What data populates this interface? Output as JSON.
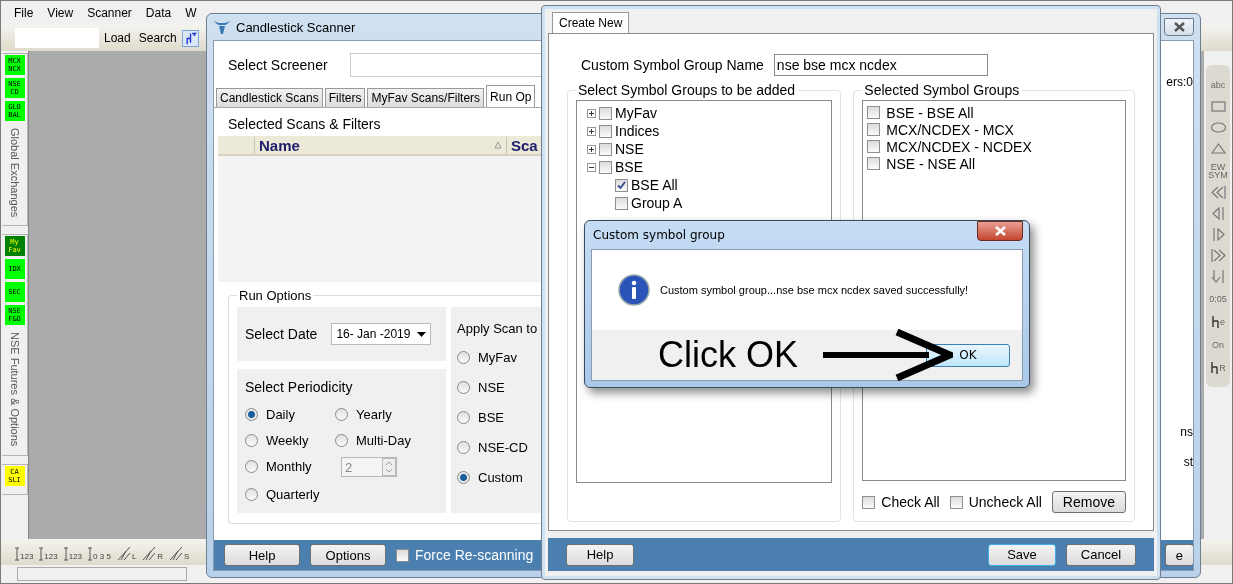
{
  "menu": [
    {
      "label": "File"
    },
    {
      "label": "View"
    },
    {
      "label": "Scanner"
    },
    {
      "label": "Data"
    },
    {
      "label": "W"
    }
  ],
  "toolbar": {
    "buttons": [
      "Load",
      "Search"
    ]
  },
  "sidebar": {
    "groups": [
      {
        "badges": [
          {
            "text": "MCX\nNCX",
            "color": "#00ff00"
          },
          {
            "text": "NSE\nCD",
            "color": "#00ff00"
          },
          {
            "text": "GLO\nBAL",
            "color": "#00ff00"
          }
        ],
        "title": "Global Exchanges"
      },
      {
        "badges": [
          {
            "text": "My\nFav",
            "color": "#008000"
          },
          {
            "text": "IDX",
            "color": "#00ff00"
          },
          {
            "text": "SEC",
            "color": "#00ff00"
          },
          {
            "text": "NSE\nF&O",
            "color": "#00ff00"
          }
        ],
        "title": "NSE Futures & Options"
      },
      {
        "badges": [
          {
            "text": "CA\nSLI",
            "color": "#ffff00"
          }
        ]
      }
    ]
  },
  "bottom_tools": [
    {
      "kind": "numbers",
      "text": "123"
    },
    {
      "kind": "numbers",
      "text": "123"
    },
    {
      "kind": "numbers",
      "text": "123"
    },
    {
      "kind": "numbers",
      "text": "0 3 5"
    },
    {
      "kind": "trend",
      "text": "L"
    },
    {
      "kind": "trend",
      "text": "R"
    },
    {
      "kind": "trend",
      "text": "S"
    }
  ],
  "right_tools": [
    {
      "kind": "text",
      "text": "abc"
    },
    {
      "kind": "rect"
    },
    {
      "kind": "ellipse"
    },
    {
      "kind": "triangle"
    },
    {
      "kind": "text",
      "text": "EW\nSYM"
    },
    {
      "kind": "arrow-left-double"
    },
    {
      "kind": "arrow-left"
    },
    {
      "kind": "arrow-right"
    },
    {
      "kind": "arrow-right-double"
    },
    {
      "kind": "arrow-down"
    },
    {
      "kind": "text",
      "text": "0:05"
    },
    {
      "kind": "cursor",
      "text": "e"
    },
    {
      "kind": "text",
      "text": "On"
    },
    {
      "kind": "cursor",
      "text": "R"
    }
  ],
  "scanner": {
    "title": "Candlestick Scanner",
    "screener_label": "Select Screener",
    "tabs": [
      {
        "label": "Candlestick Scans",
        "selected": false
      },
      {
        "label": "Filters",
        "selected": false
      },
      {
        "label": "MyFav Scans/Filters",
        "selected": false
      },
      {
        "label": "Run Op",
        "selected": true
      }
    ],
    "selected_title": "Selected Scans & Filters",
    "columns": [
      "Name",
      "Sca"
    ],
    "run_options": {
      "title": "Run Options",
      "date_label": "Select Date",
      "date_value": "16- Jan -2019",
      "periodicity_title": "Select Periodicity",
      "periodicity": [
        {
          "label": "Daily",
          "selected": true
        },
        {
          "label": "Yearly",
          "selected": false
        },
        {
          "label": "Weekly",
          "selected": false
        },
        {
          "label": "Multi-Day",
          "selected": false
        },
        {
          "label": "Monthly",
          "selected": false
        },
        {
          "label": "Quarterly",
          "selected": false
        }
      ],
      "multi_day_value": "2",
      "apply_title": "Apply Scan to",
      "apply": [
        {
          "label": "MyFav",
          "selected": false
        },
        {
          "label": "NSE",
          "selected": false
        },
        {
          "label": "BSE",
          "selected": false
        },
        {
          "label": "NSE-CD",
          "selected": false
        },
        {
          "label": "Custom",
          "selected": true
        }
      ]
    },
    "right_fragments": [
      "ers:0",
      "ns",
      "st"
    ],
    "footer": {
      "buttons": [
        "Help",
        "Options"
      ],
      "force_rescan": {
        "label": "Force Re-scanning",
        "checked": false
      },
      "partial_button": "e"
    }
  },
  "create": {
    "tab": {
      "label": "Create New",
      "selected": true
    },
    "name_label": "Custom Symbol Group Name",
    "name_value": "nse bse mcx ncdex",
    "source_title": "Select Symbol Groups to be added",
    "tree": [
      {
        "label": "MyFav",
        "checked": false,
        "expanded": false
      },
      {
        "label": "Indices",
        "checked": false,
        "expanded": false
      },
      {
        "label": "NSE",
        "checked": false,
        "expanded": false
      },
      {
        "label": "BSE",
        "checked": false,
        "expanded": true,
        "children": [
          {
            "label": "BSE All",
            "checked": true
          },
          {
            "label": "Group A",
            "checked": false
          }
        ]
      }
    ],
    "selected_title": "Selected Symbol Groups",
    "selected_items": [
      {
        "label": "BSE - BSE All",
        "checked": false
      },
      {
        "label": "MCX/NCDEX - MCX",
        "checked": false
      },
      {
        "label": "MCX/NCDEX - NCDEX",
        "checked": false
      },
      {
        "label": "NSE - NSE All",
        "checked": false
      }
    ],
    "check_all": {
      "label": "Check All",
      "checked": false
    },
    "uncheck_all": {
      "label": "Uncheck All",
      "checked": false
    },
    "remove": "Remove",
    "footer_buttons": [
      {
        "label": "Help",
        "default": false
      },
      {
        "label": "Save",
        "default": true
      },
      {
        "label": "Cancel",
        "default": false
      }
    ]
  },
  "dialog": {
    "title": "Custom symbol group",
    "message": "Custom symbol group...nse bse mcx ncdex saved successfully!",
    "annotation": "Click OK",
    "ok": "OK"
  }
}
